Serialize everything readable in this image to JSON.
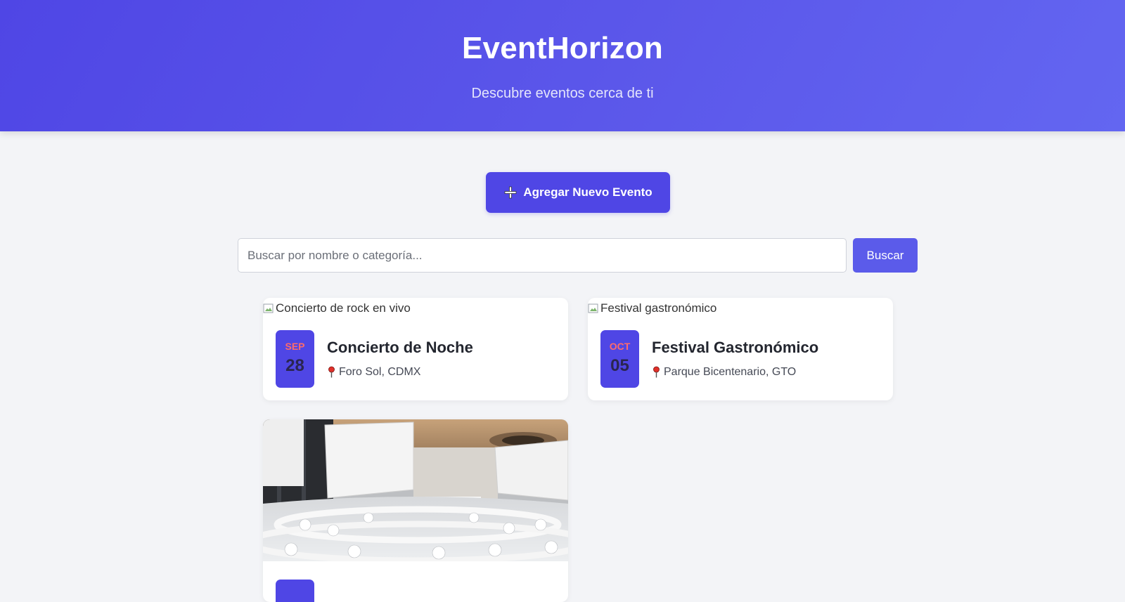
{
  "header": {
    "title": "EventHorizon",
    "subtitle": "Descubre eventos cerca de ti"
  },
  "actions": {
    "add_event_label": "Agregar Nuevo Evento"
  },
  "search": {
    "placeholder": "Buscar por nombre o categoría...",
    "value": "",
    "button_label": "Buscar"
  },
  "events": [
    {
      "image_alt": "Concierto de rock en vivo",
      "month": "SEP",
      "day": "28",
      "title": "Concierto de Noche",
      "location": "Foro Sol, CDMX"
    },
    {
      "image_alt": "Festival gastronómico",
      "month": "OCT",
      "day": "05",
      "title": "Festival Gastronómico",
      "location": "Parque Bicentenario, GTO"
    },
    {
      "image": "conference-hall-photo"
    }
  ],
  "colors": {
    "primary": "#4f46e5",
    "accent_month": "#ff6b6b",
    "background": "#f3f4f7"
  }
}
